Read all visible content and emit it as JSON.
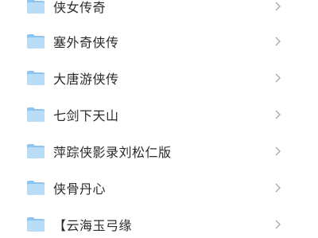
{
  "folder_list": {
    "items": [
      {
        "label": "侠女传奇",
        "icon": "folder-icon"
      },
      {
        "label": "塞外奇侠传",
        "icon": "folder-icon"
      },
      {
        "label": "大唐游侠传",
        "icon": "folder-icon"
      },
      {
        "label": "七剑下天山",
        "icon": "folder-icon"
      },
      {
        "label": "萍踪侠影录刘松仁版",
        "icon": "folder-icon"
      },
      {
        "label": "侠骨丹心",
        "icon": "folder-icon"
      },
      {
        "label": "【云海玉弓缘",
        "icon": "folder-icon"
      }
    ]
  },
  "colors": {
    "folder": "#b9dcf7",
    "folder_tab": "#8ec5f0",
    "text": "#2b2b2b",
    "chevron": "#aaaaaa"
  }
}
